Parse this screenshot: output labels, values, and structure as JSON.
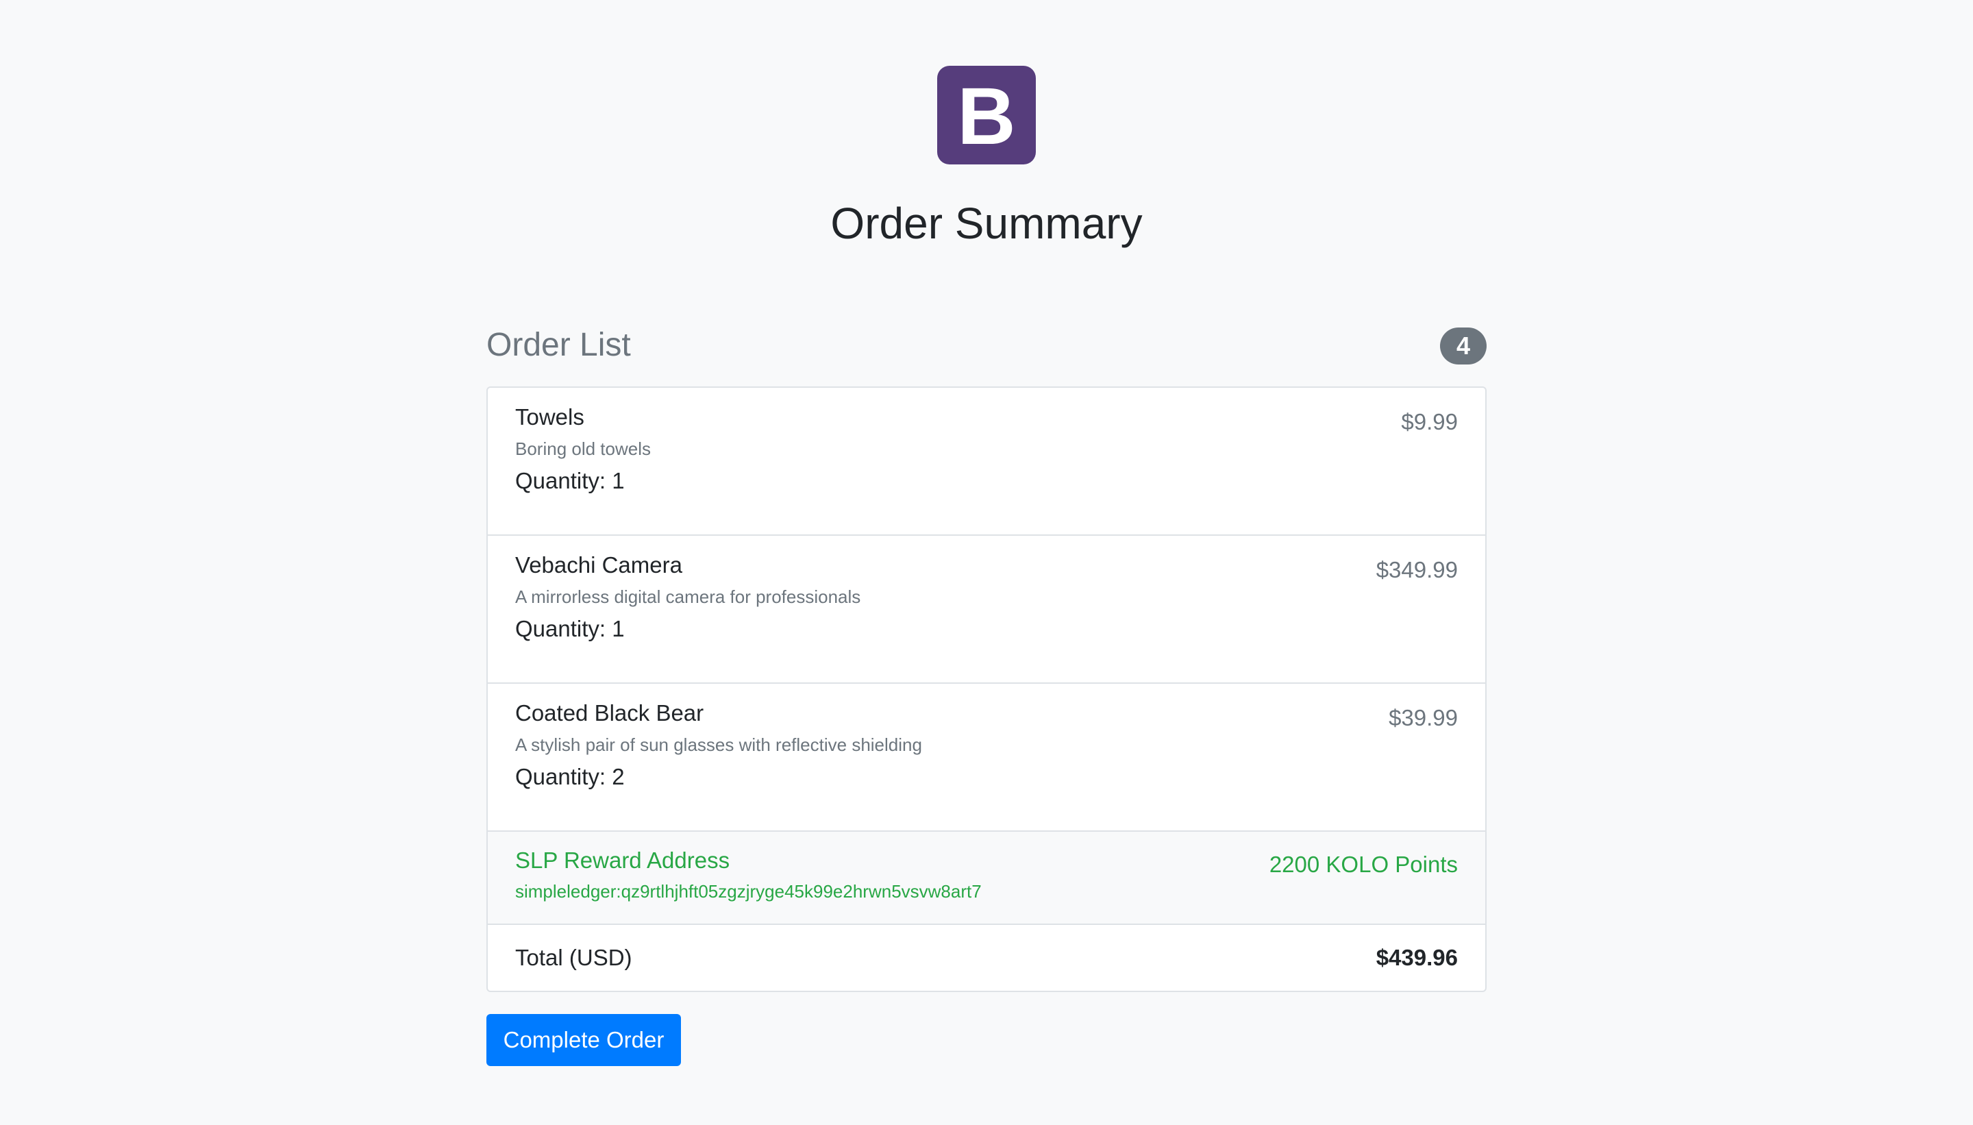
{
  "logo": {
    "letter": "B",
    "color": "#563d7c"
  },
  "page_title": "Order Summary",
  "order_list": {
    "title": "Order List",
    "count": "4",
    "items": [
      {
        "name": "Towels",
        "description": "Boring old towels",
        "quantity": "Quantity: 1",
        "price": "$9.99"
      },
      {
        "name": "Vebachi Camera",
        "description": "A mirrorless digital camera for professionals",
        "quantity": "Quantity: 1",
        "price": "$349.99"
      },
      {
        "name": "Coated Black Bear",
        "description": "A stylish pair of sun glasses with reflective shielding",
        "quantity": "Quantity: 2",
        "price": "$39.99"
      }
    ],
    "reward": {
      "title": "SLP Reward Address",
      "address": "simpleledger:qz9rtlhjhft05zgzjryge45k99e2hrwn5vsvw8art7",
      "points": "2200 KOLO Points"
    },
    "total": {
      "label": "Total (USD)",
      "value": "$439.96"
    }
  },
  "actions": {
    "complete_label": "Complete Order"
  },
  "colors": {
    "accent": "#007bff",
    "success": "#28a745",
    "muted": "#6c757d",
    "brand": "#563d7c"
  }
}
